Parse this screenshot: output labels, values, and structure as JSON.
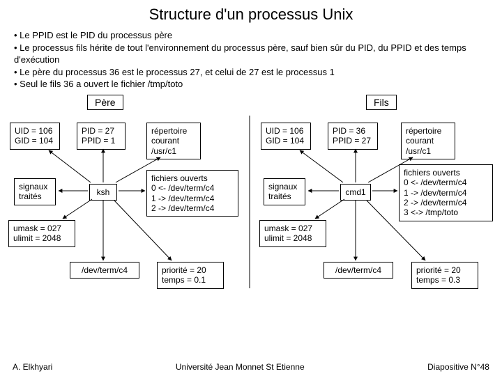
{
  "title": "Structure d'un processus Unix",
  "bullets": [
    "• Le PPID est le PID du processus père",
    "• Le processus fils hérite de tout l'environnement du processus père, sauf bien sûr du PID, du PPID et des temps d'exécution",
    "• Le père du processus 36 est le processus 27, et celui de 27 est le processus 1",
    "• Seul le fils 36 a ouvert le fichier /tmp/toto"
  ],
  "sections": {
    "left": "Père",
    "right": "Fils"
  },
  "left": {
    "uid": "UID = 106\nGID = 104",
    "pid": "PID = 27\nPPID = 1",
    "dir": "répertoire\ncourant\n/usr/c1",
    "sig": "signaux\ntraités",
    "sh": "ksh",
    "fd": "fichiers ouverts\n0 <- /dev/term/c4\n1 -> /dev/term/c4\n2 -> /dev/term/c4",
    "um": "umask = 027\nulimit = 2048",
    "dev": "/dev/term/c4",
    "pri": "priorité = 20\ntemps = 0.1"
  },
  "right": {
    "uid": "UID = 106\nGID = 104",
    "pid": "PID = 36\nPPID = 27",
    "dir": "répertoire\ncourant\n/usr/c1",
    "sig": "signaux\ntraités",
    "sh": "cmd1",
    "fd": "fichiers ouverts\n0 <- /dev/term/c4\n1 -> /dev/term/c4\n2 -> /dev/term/c4\n3 <-> /tmp/toto",
    "um": "umask = 027\nulimit = 2048",
    "dev": "/dev/term/c4",
    "pri": "priorité = 20\ntemps = 0.3"
  },
  "footer": {
    "author": "A. Elkhyari",
    "uni": "Université Jean Monnet St Etienne",
    "slide": "Diapositive N°48"
  }
}
